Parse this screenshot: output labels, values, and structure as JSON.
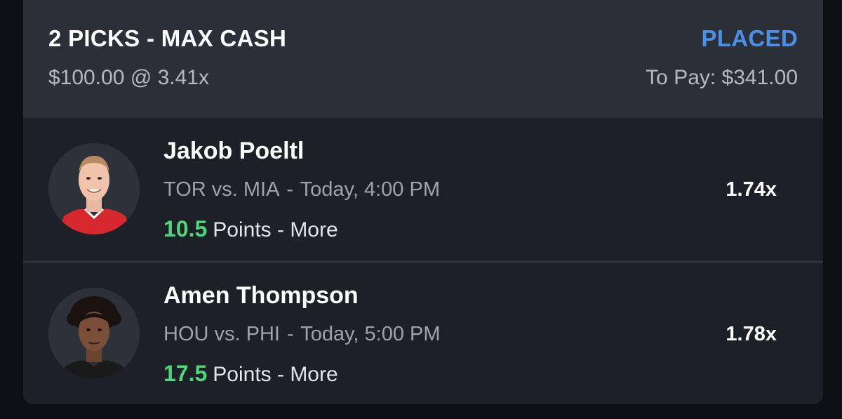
{
  "entry": {
    "title": "2 PICKS - MAX CASH",
    "status": "PLACED",
    "stake": "$100.00 @ 3.41x",
    "to_pay": "To Pay: $341.00"
  },
  "picks": [
    {
      "player": "Jakob Poeltl",
      "matchup": "TOR vs. MIA",
      "separator": "-",
      "time": "Today, 4:00 PM",
      "line": "10.5",
      "stat": "Points - More",
      "multiplier": "1.74x",
      "avatar_icon": "player-headshot-icon"
    },
    {
      "player": "Amen Thompson",
      "matchup": "HOU vs. PHI",
      "separator": "-",
      "time": "Today, 5:00 PM",
      "line": "17.5",
      "stat": "Points - More",
      "multiplier": "1.78x",
      "avatar_icon": "player-headshot-icon"
    }
  ],
  "colors": {
    "status": "#4a8fe8",
    "line_value": "#4fd67b",
    "header_bg": "#2b2f37",
    "card_bg": "#1d2026"
  }
}
